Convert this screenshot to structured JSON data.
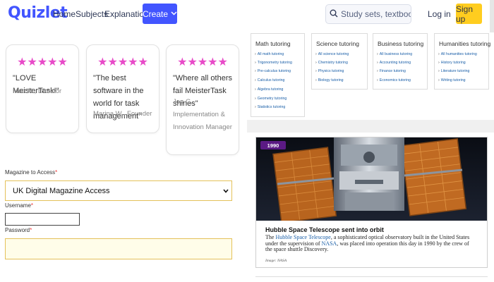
{
  "header": {
    "logo": "Quizlet",
    "nav": {
      "home": "Home",
      "subjects": "Subjects",
      "explanations": "Explanations"
    },
    "create_label": "Create",
    "search_placeholder": "Study sets, textbooks, ...",
    "login_label": "Log in",
    "signup_label": "Sign up",
    "colors": {
      "brand": "#4255ff",
      "signup": "#ffcd1f"
    }
  },
  "testimonials": [
    {
      "stars": "★★★★★",
      "quote": "\"LOVE MeisterTask!\"",
      "author": "Matt H., Director"
    },
    {
      "stars": "★★★★★",
      "quote": "\"The best software in the world for task management\"",
      "author": "Marina W., Founder"
    },
    {
      "stars": "★★★★★",
      "quote": "\"Where all others fail MeisterTask shines\"",
      "author": "Jon G., Implementation & Innovation Manager"
    }
  ],
  "form": {
    "magazine_label": "Magazine to Access",
    "required_mark": "*",
    "magazine_value": "UK Digital Magazine Access",
    "username_label": "Username",
    "password_label": "Password"
  },
  "tutoring": [
    {
      "title": "Math tutoring",
      "items": [
        "All math tutoring",
        "Trigonometry tutoring",
        "Pre-calculus tutoring",
        "Calculus tutoring",
        "Algebra tutoring",
        "Geometry tutoring",
        "Statistics tutoring"
      ]
    },
    {
      "title": "Science tutoring",
      "items": [
        "All science tutoring",
        "Chemistry tutoring",
        "Physics tutoring",
        "Biology tutoring"
      ]
    },
    {
      "title": "Business tutoring",
      "items": [
        "All business tutoring",
        "Accounting tutoring",
        "Finance tutoring",
        "Economics tutoring"
      ]
    },
    {
      "title": "Humanities tutoring",
      "items": [
        "All humanities tutoring",
        "History tutoring",
        "Literature tutoring",
        "Writing tutoring"
      ]
    }
  ],
  "hubble": {
    "year": "1990",
    "title": "Hubble Space Telescope sent into orbit",
    "body": {
      "p1": "The ",
      "link1": "Hubble Space Telescope",
      "p2": ", a sophisticated optical observatory built in the United States under the supervision of ",
      "link2": "NASA",
      "p3": ", was placed into operation this day in 1990 by the crew of the space shuttle Discovery."
    },
    "credit": "Image: NASA"
  }
}
